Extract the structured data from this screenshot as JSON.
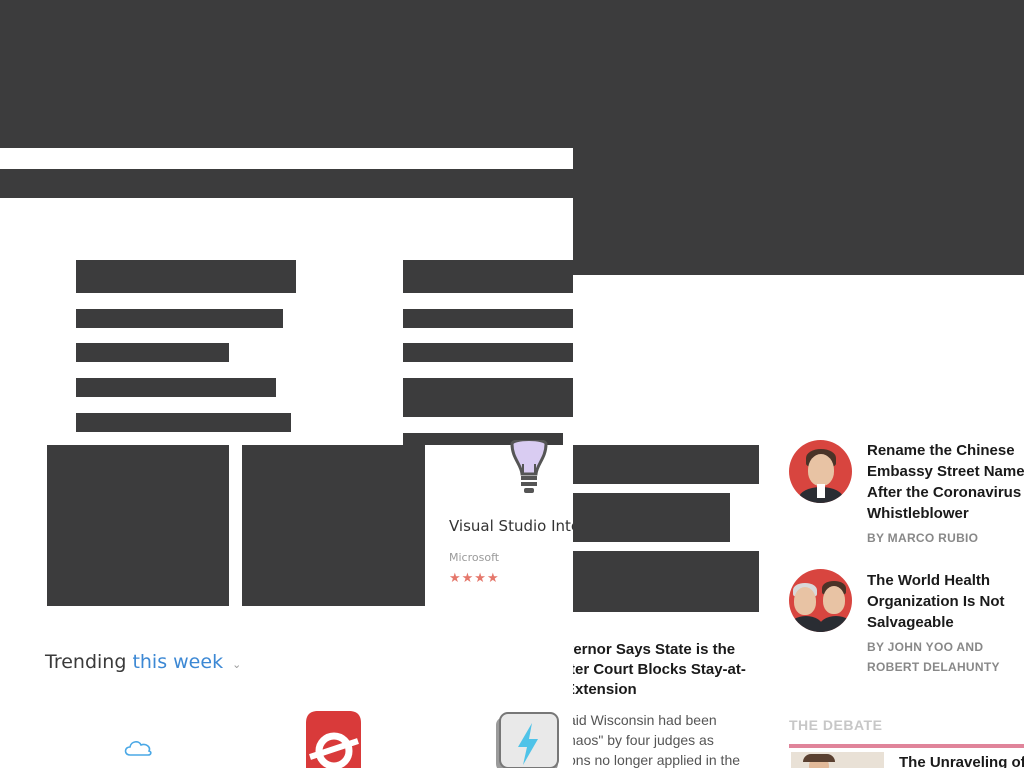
{
  "app_store": {
    "trending": {
      "label": "Trending",
      "period": "this week",
      "chevron": "⌄"
    },
    "featured_app": {
      "title": "Visual Studio Inte",
      "publisher": "Microsoft",
      "rating_stars": "★★★★",
      "icon": "lightbulb-icon"
    },
    "trending_icons": [
      "cloud-icon",
      "red-app-icon",
      "lightning-battery-icon"
    ]
  },
  "news": {
    "main_story": {
      "headline": "vernor Says State is the\nfter Court Blocks Stay-at-\nExtension",
      "snippet": "aid Wisconsin had been\nhaos\" by four judges as\nons no longer applied in the"
    },
    "articles": [
      {
        "title": "Rename the Chinese Embassy Street Name After the Coronavirus Whistleblower",
        "byline": "BY MARCO RUBIO"
      },
      {
        "title": "The World Health Organization Is Not Salvageable",
        "byline": "BY JOHN YOO AND ROBERT DELAHUNTY"
      }
    ],
    "debate": {
      "label": "THE DEBATE",
      "title": "The Unraveling of",
      "rule_color": "#e0849a"
    }
  },
  "colors": {
    "redaction": "#3c3c3d",
    "accent_blue": "#3c88d4",
    "star_color": "#e5776b",
    "avatar_bg": "#d8453f"
  }
}
